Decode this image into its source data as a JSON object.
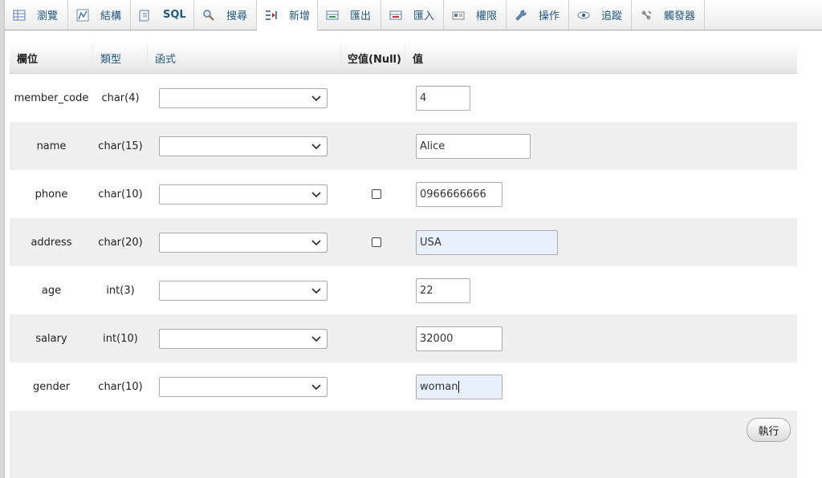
{
  "tabs": [
    {
      "label": "瀏覽",
      "icon": "browse-icon"
    },
    {
      "label": "結構",
      "icon": "structure-icon"
    },
    {
      "label": "SQL",
      "icon": "sql-icon"
    },
    {
      "label": "搜尋",
      "icon": "search-icon"
    },
    {
      "label": "新增",
      "icon": "insert-icon",
      "active": true
    },
    {
      "label": "匯出",
      "icon": "export-icon"
    },
    {
      "label": "匯入",
      "icon": "import-icon"
    },
    {
      "label": "權限",
      "icon": "privileges-icon"
    },
    {
      "label": "操作",
      "icon": "operations-icon"
    },
    {
      "label": "追蹤",
      "icon": "tracking-icon"
    },
    {
      "label": "觸發器",
      "icon": "triggers-icon"
    }
  ],
  "table": {
    "headers": {
      "column": "欄位",
      "type": "類型",
      "function": "函式",
      "null": "空值(Null)",
      "value": "值"
    },
    "rows": [
      {
        "column": "member_code",
        "type": "char(4)",
        "function": "",
        "nullable": false,
        "value": "4"
      },
      {
        "column": "name",
        "type": "char(15)",
        "function": "",
        "nullable": false,
        "value": "Alice"
      },
      {
        "column": "phone",
        "type": "char(10)",
        "function": "",
        "nullable": true,
        "null_checked": false,
        "value": "0966666666"
      },
      {
        "column": "address",
        "type": "char(20)",
        "function": "",
        "nullable": true,
        "null_checked": false,
        "value": "USA"
      },
      {
        "column": "age",
        "type": "int(3)",
        "function": "",
        "nullable": false,
        "value": "22"
      },
      {
        "column": "salary",
        "type": "int(10)",
        "function": "",
        "nullable": false,
        "value": "32000"
      },
      {
        "column": "gender",
        "type": "char(10)",
        "function": "",
        "nullable": false,
        "value": "woman"
      }
    ]
  },
  "execute_label": "執行",
  "colors": {
    "link": "#235a81",
    "row_alt": "#f0f0f0",
    "autofill": "#e8f0fe"
  }
}
